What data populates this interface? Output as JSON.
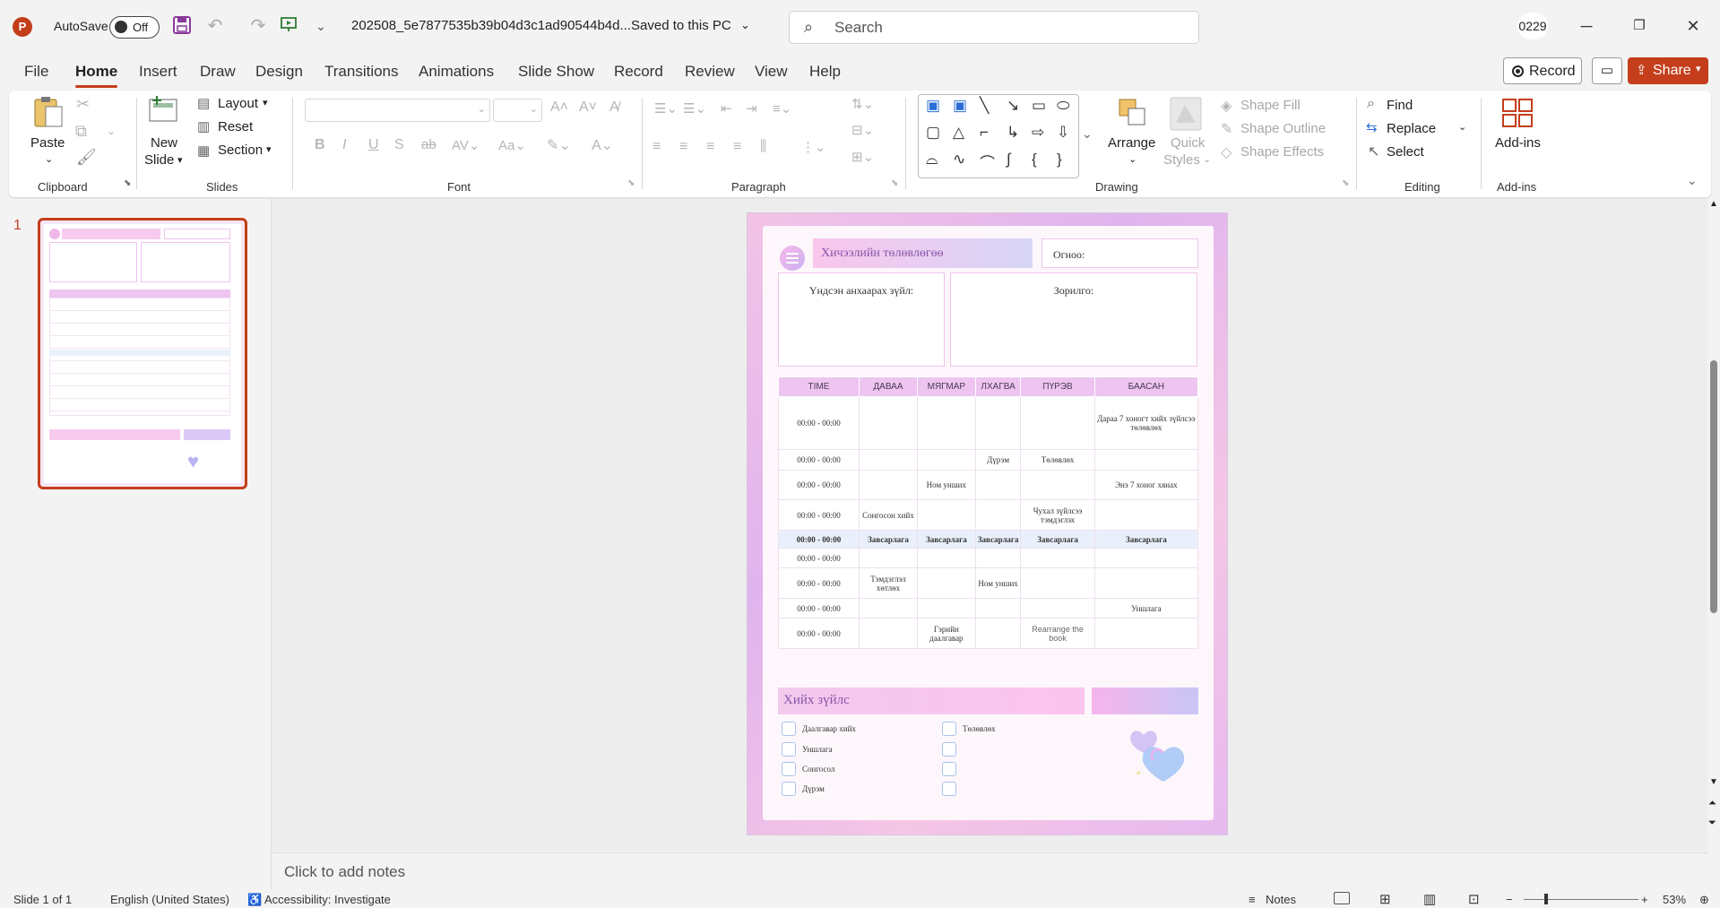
{
  "titlebar": {
    "autosave_label": "AutoSave",
    "autosave_state": "Off",
    "filename": "202508_5e7877535b39b04d3c1ad90544b4d...",
    "save_status": "Saved to this PC",
    "search_placeholder": "Search",
    "user_initials": "0229"
  },
  "menu": {
    "tabs": [
      "File",
      "Home",
      "Insert",
      "Draw",
      "Design",
      "Transitions",
      "Animations",
      "Slide Show",
      "Record",
      "Review",
      "View",
      "Help"
    ],
    "active": "Home",
    "record_label": "Record",
    "share_label": "Share"
  },
  "ribbon": {
    "clipboard": {
      "label": "Clipboard",
      "paste": "Paste"
    },
    "slides": {
      "label": "Slides",
      "new_slide_1": "New",
      "new_slide_2": "Slide",
      "layout": "Layout",
      "reset": "Reset",
      "section": "Section"
    },
    "font": {
      "label": "Font"
    },
    "paragraph": {
      "label": "Paragraph"
    },
    "drawing": {
      "label": "Drawing",
      "arrange": "Arrange",
      "quick_styles_1": "Quick",
      "quick_styles_2": "Styles",
      "shape_fill": "Shape Fill",
      "shape_outline": "Shape Outline",
      "shape_effects": "Shape Effects"
    },
    "editing": {
      "label": "Editing",
      "find": "Find",
      "replace": "Replace",
      "select": "Select"
    },
    "addins": {
      "label": "Add-ins",
      "addins": "Add-ins"
    }
  },
  "thumbnail": {
    "number": "1"
  },
  "slide": {
    "title": "Хичээлийн төлөвлөгөө",
    "date_label": "Огноо:",
    "main_task_label": "Үндсэн анхаарах зүйл:",
    "goal_label": "Зорилго:",
    "schedule": {
      "headers": [
        "TIME",
        "ДАВАА",
        "МЯГМАР",
        "ЛХАГВА",
        "ПҮРЭВ",
        "БААСАН"
      ],
      "rows": [
        [
          "00:00 - 00:00",
          "",
          "",
          "",
          "",
          "Дараа 7 хоногт хийх зүйлсээ төлөвлөх"
        ],
        [
          "00:00 - 00:00",
          "",
          "",
          "Дүрэм",
          "Төлөвлөх",
          ""
        ],
        [
          "00:00 - 00:00",
          "",
          "Ном унших",
          "",
          "",
          "Энэ 7 хоног хянах"
        ],
        [
          "00:00 - 00:00",
          "Сонгосон хийх",
          "",
          "",
          "Чухал зүйлсээ тэмдэглэх",
          ""
        ],
        [
          "00:00 - 00:00",
          "Завсарлага",
          "Завсарлага",
          "Завсарлага",
          "Завсарлага",
          "Завсарлага"
        ],
        [
          "00:00 - 00:00",
          "",
          "",
          "",
          "",
          ""
        ],
        [
          "00:00 - 00:00",
          "Тэмдэглэл хөтлөх",
          "",
          "Ном унших",
          "",
          ""
        ],
        [
          "00:00 - 00:00",
          "",
          "",
          "",
          "",
          "Уншлага"
        ],
        [
          "00:00 - 00:00",
          "",
          "Гэрийн даалгавар",
          "",
          "Rearrange the book",
          ""
        ]
      ]
    },
    "todo_title": "Хийх зүйлс",
    "todo_left": [
      "Даалгавар хийх",
      "Уншлага",
      "Сонгосол",
      "Дүрэм"
    ],
    "todo_right": [
      "Төлөвлөх"
    ]
  },
  "notes_placeholder": "Click to add notes",
  "status": {
    "slide_info": "Slide 1 of 1",
    "language": "English (United States)",
    "accessibility": "Accessibility: Investigate",
    "notes": "Notes",
    "zoom": "53%"
  }
}
